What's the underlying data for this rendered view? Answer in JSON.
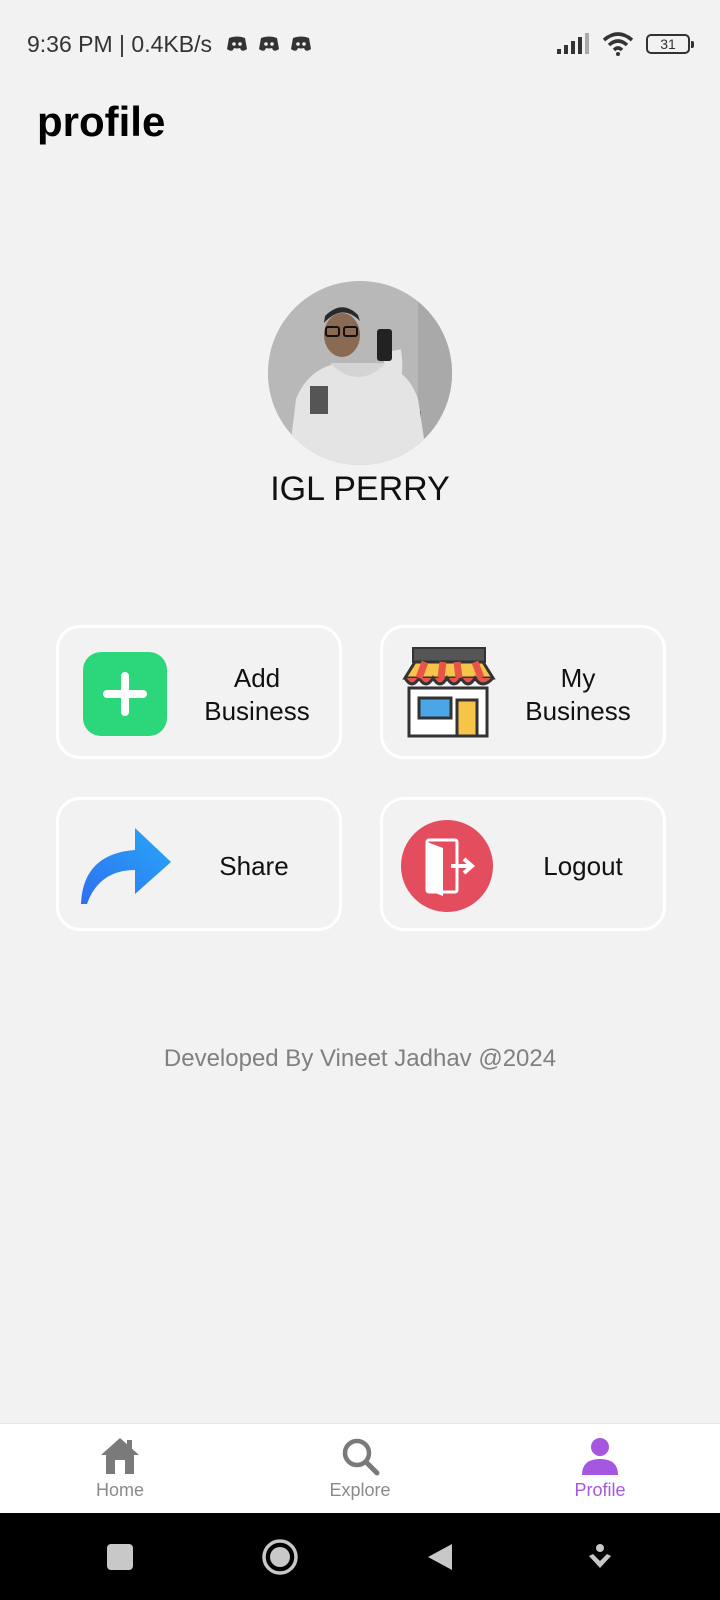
{
  "status_bar": {
    "time_speed": "9:36 PM | 0.4KB/s",
    "battery": "31",
    "icons": [
      "discord-icon",
      "discord-icon",
      "discord-icon",
      "signal-icon",
      "wifi-icon",
      "battery-icon"
    ]
  },
  "page": {
    "title": "profile"
  },
  "user": {
    "name": "IGL PERRY"
  },
  "actions": {
    "add_business": {
      "line1": "Add",
      "line2": "Business",
      "icon": "plus-icon",
      "color": "#2cd67a"
    },
    "my_business": {
      "line1": "My",
      "line2": "Business",
      "icon": "store-icon"
    },
    "share": {
      "label": "Share",
      "icon": "share-arrow-icon",
      "color": "#3a86f5"
    },
    "logout": {
      "label": "Logout",
      "icon": "logout-door-icon",
      "color": "#e34d5e"
    }
  },
  "footer": {
    "credit": "Developed By Vineet Jadhav @2024"
  },
  "bottom_nav": {
    "items": [
      {
        "label": "Home",
        "icon": "home-icon",
        "active": false
      },
      {
        "label": "Explore",
        "icon": "search-icon",
        "active": false
      },
      {
        "label": "Profile",
        "icon": "person-icon",
        "active": true
      }
    ],
    "active_color": "#a557e0"
  },
  "system_nav": {
    "buttons": [
      "recents-icon",
      "home-circle-icon",
      "back-icon",
      "assist-icon"
    ]
  }
}
